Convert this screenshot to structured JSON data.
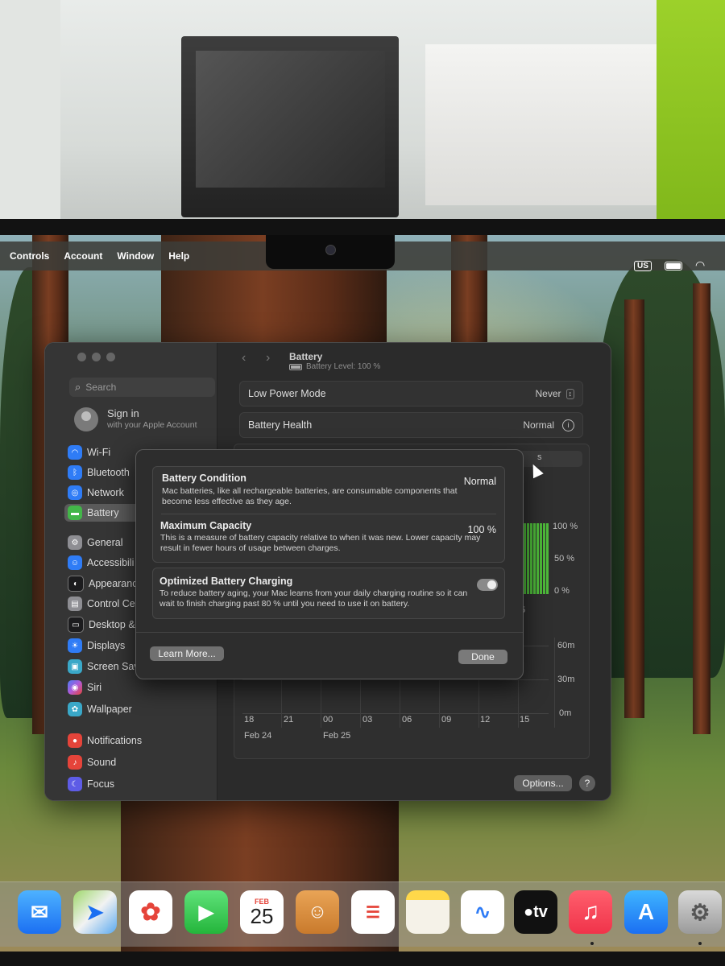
{
  "menubar": {
    "items": [
      "Controls",
      "Account",
      "Window",
      "Help"
    ],
    "input_source": "US"
  },
  "sidebar": {
    "search_placeholder": "Search",
    "signin_title": "Sign in",
    "signin_subtitle": "with your Apple Account",
    "items": [
      {
        "label": "Wi-Fi",
        "icon": "wifi-icon",
        "color": "#2f7cf6"
      },
      {
        "label": "Bluetooth",
        "icon": "bluetooth-icon",
        "color": "#2f7cf6"
      },
      {
        "label": "Network",
        "icon": "globe-icon",
        "color": "#2f7cf6"
      },
      {
        "label": "Battery",
        "icon": "battery-icon",
        "color": "#43b649"
      },
      {
        "label": "General",
        "icon": "gear-icon",
        "color": "#8e8e93"
      },
      {
        "label": "Accessibili",
        "icon": "accessibility-icon",
        "color": "#2f7cf6"
      },
      {
        "label": "Appearanc",
        "icon": "appearance-icon",
        "color": "#1c1c1e"
      },
      {
        "label": "Control Cen",
        "icon": "control-center-icon",
        "color": "#8e8e93"
      },
      {
        "label": "Desktop &",
        "icon": "desktop-icon",
        "color": "#1c1c1e"
      },
      {
        "label": "Displays",
        "icon": "sun-icon",
        "color": "#2f7cf6"
      },
      {
        "label": "Screen Sav",
        "icon": "screensaver-icon",
        "color": "#3aa8c8"
      },
      {
        "label": "Siri",
        "icon": "siri-icon",
        "color": "#b05ad8"
      },
      {
        "label": "Wallpaper",
        "icon": "wallpaper-icon",
        "color": "#3aa8c8"
      },
      {
        "label": "Notifications",
        "icon": "bell-icon",
        "color": "#e5443a"
      },
      {
        "label": "Sound",
        "icon": "speaker-icon",
        "color": "#e5443a"
      },
      {
        "label": "Focus",
        "icon": "moon-icon",
        "color": "#5e5ce6"
      }
    ]
  },
  "pane": {
    "title": "Battery",
    "subtitle": "Battery Level: 100 %",
    "low_power_label": "Low Power Mode",
    "low_power_value": "Never",
    "health_label": "Battery Health",
    "health_value": "Normal",
    "options_label": "Options...",
    "help_label": "?"
  },
  "chart": {
    "level_ticks": [
      "100 %",
      "50 %",
      "0 %"
    ],
    "usage_ticks": [
      "60m",
      "30m",
      "0m"
    ],
    "x_ticks": [
      "18",
      "21",
      "00",
      "03",
      "06",
      "09",
      "12",
      "15"
    ],
    "date_labels": [
      "Feb 24",
      "Feb 25"
    ],
    "fragment_top": "s",
    "fragment_mid": "5",
    "level_values": [
      100,
      100,
      100,
      100,
      100,
      100,
      100,
      100,
      100
    ]
  },
  "dialog": {
    "condition_title": "Battery Condition",
    "condition_value": "Normal",
    "condition_desc": "Mac batteries, like all rechargeable batteries, are consumable components that become less effective as they age.",
    "capacity_title": "Maximum Capacity",
    "capacity_value": "100 %",
    "capacity_desc": "This is a measure of battery capacity relative to when it was new. Lower capacity may result in fewer hours of usage between charges.",
    "optimized_title": "Optimized Battery Charging",
    "optimized_desc": "To reduce battery aging, your Mac learns from your daily charging routine so it can wait to finish charging past 80 % until you need to use it on battery.",
    "optimized_on": true,
    "learn_more": "Learn More...",
    "done": "Done"
  },
  "dock": {
    "calendar_month": "FEB",
    "calendar_day": "25",
    "tv_label": "tv",
    "apps": [
      "mail",
      "maps",
      "photos",
      "facetime",
      "calendar",
      "contacts",
      "reminders",
      "notes",
      "freeform",
      "tv",
      "music",
      "app-store",
      "system-settings"
    ]
  }
}
